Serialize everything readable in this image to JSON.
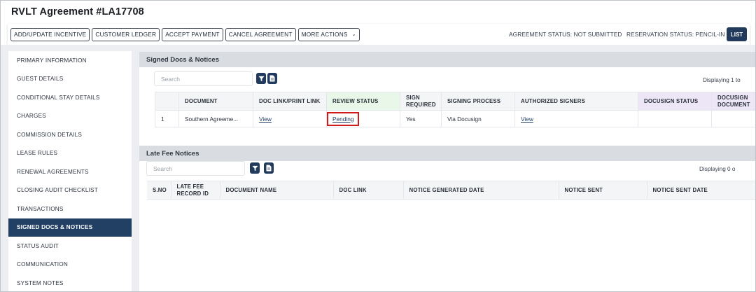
{
  "title": "RVLT Agreement #LA17708",
  "toolbar": {
    "buttons": [
      "ADD/UPDATE INCENTIVE",
      "CUSTOMER LEDGER",
      "ACCEPT PAYMENT",
      "CANCEL AGREEMENT"
    ],
    "more_actions": "MORE ACTIONS",
    "agreement_status": "AGREEMENT STATUS: NOT SUBMITTED",
    "reservation_status": "RESERVATION STATUS: PENCIL-IN",
    "list_label": "LIST"
  },
  "sidebar": {
    "items": [
      "PRIMARY INFORMATION",
      "GUEST DETAILS",
      "CONDITIONAL STAY DETAILS",
      "CHARGES",
      "COMMISSION DETAILS",
      "LEASE RULES",
      "RENEWAL AGREEMENTS",
      "CLOSING AUDIT CHECKLIST",
      "TRANSACTIONS",
      "SIGNED DOCS & NOTICES",
      "STATUS AUDIT",
      "COMMUNICATION",
      "SYSTEM NOTES"
    ],
    "active_index": 9
  },
  "signed_docs": {
    "heading": "Signed Docs & Notices",
    "search_placeholder": "Search",
    "displaying": "Displaying 1 to",
    "columns": [
      "",
      "DOCUMENT",
      "DOC LINK/PRINT LINK",
      "REVIEW STATUS",
      "SIGN REQUIRED",
      "SIGNING PROCESS",
      "AUTHORIZED SIGNERS",
      "DOCUSIGN STATUS",
      "DOCUSIGN DOCUMENT"
    ],
    "rows": [
      {
        "num": "1",
        "document": "Southern Agreeme...",
        "doc_link": "View",
        "review_status": "Pending",
        "sign_required": "Yes",
        "signing_process": "Via Docusign",
        "authorized_signers": "View",
        "docusign_status": "",
        "docusign_document": ""
      }
    ]
  },
  "late_fee": {
    "heading": "Late Fee Notices",
    "search_placeholder": "Search",
    "displaying": "Displaying 0 o",
    "columns": [
      "S.NO",
      "LATE FEE RECORD ID",
      "DOCUMENT NAME",
      "DOC LINK",
      "NOTICE GENERATED DATE",
      "NOTICE SENT",
      "NOTICE SENT DATE"
    ]
  },
  "colors": {
    "brand_navy": "#223a5c",
    "highlight_red": "#d11b1b",
    "review_col_bg": "#e8f7e8",
    "docusign_col_bg": "#ece6f6"
  }
}
